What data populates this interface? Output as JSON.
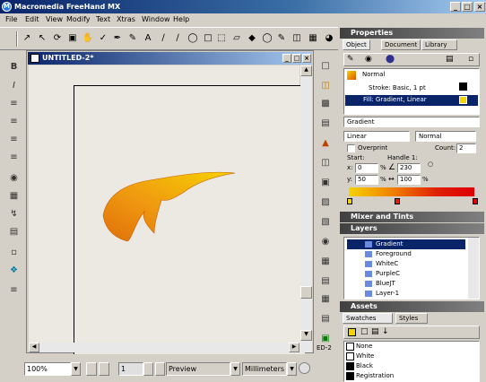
{
  "app": {
    "title": "Macromedia FreeHand MX",
    "logo_text": "M"
  },
  "window_controls": {
    "minimize": "_",
    "maximize": "□",
    "close": "×"
  },
  "menu": [
    "File",
    "Edit",
    "View",
    "Modify",
    "Text",
    "Xtras",
    "Window",
    "Help"
  ],
  "document": {
    "title": "UNTITLED-2*",
    "page_number": "1"
  },
  "status": {
    "zoom": "100%",
    "view_mode": "Preview",
    "units": "Millimeters"
  },
  "shape_colors": {
    "yellow": "#f5d300",
    "orange": "#f09a10",
    "dark_orange": "#e0700a"
  },
  "properties": {
    "header": "Properties",
    "tabs": [
      "Object",
      "Document",
      "Library"
    ],
    "items": [
      "Normal",
      "Stroke: Basic, 1 pt",
      "Fill: Gradient, Linear"
    ],
    "fill_type": "Gradient",
    "gradient_type": "Linear",
    "blend": "Normal",
    "overprint": "Overprint",
    "count_label": "Count:",
    "count_value": "2",
    "start_label": "Start:",
    "x_label": "x:",
    "x_value": "0",
    "y_label": "y:",
    "y_value": "50",
    "handle_label": "Handle 1:",
    "angle_value": "230",
    "handle_pct": "100",
    "pct": "%"
  },
  "mixer": {
    "header": "Mixer and Tints"
  },
  "layers": {
    "header": "Layers",
    "items": [
      "Gradient",
      "Foreground",
      "WhiteC",
      "PurpleC",
      "BlueJT",
      "Layer-1"
    ]
  },
  "assets": {
    "header": "Assets",
    "tabs": [
      "Swatches",
      "Styles"
    ],
    "swatches": [
      {
        "name": "None",
        "color": "#ffffff"
      },
      {
        "name": "White",
        "color": "#ffffff"
      },
      {
        "name": "Black",
        "color": "#000000"
      },
      {
        "name": "Registration",
        "color": "#000000"
      }
    ]
  },
  "zoom_label": "ED-2"
}
